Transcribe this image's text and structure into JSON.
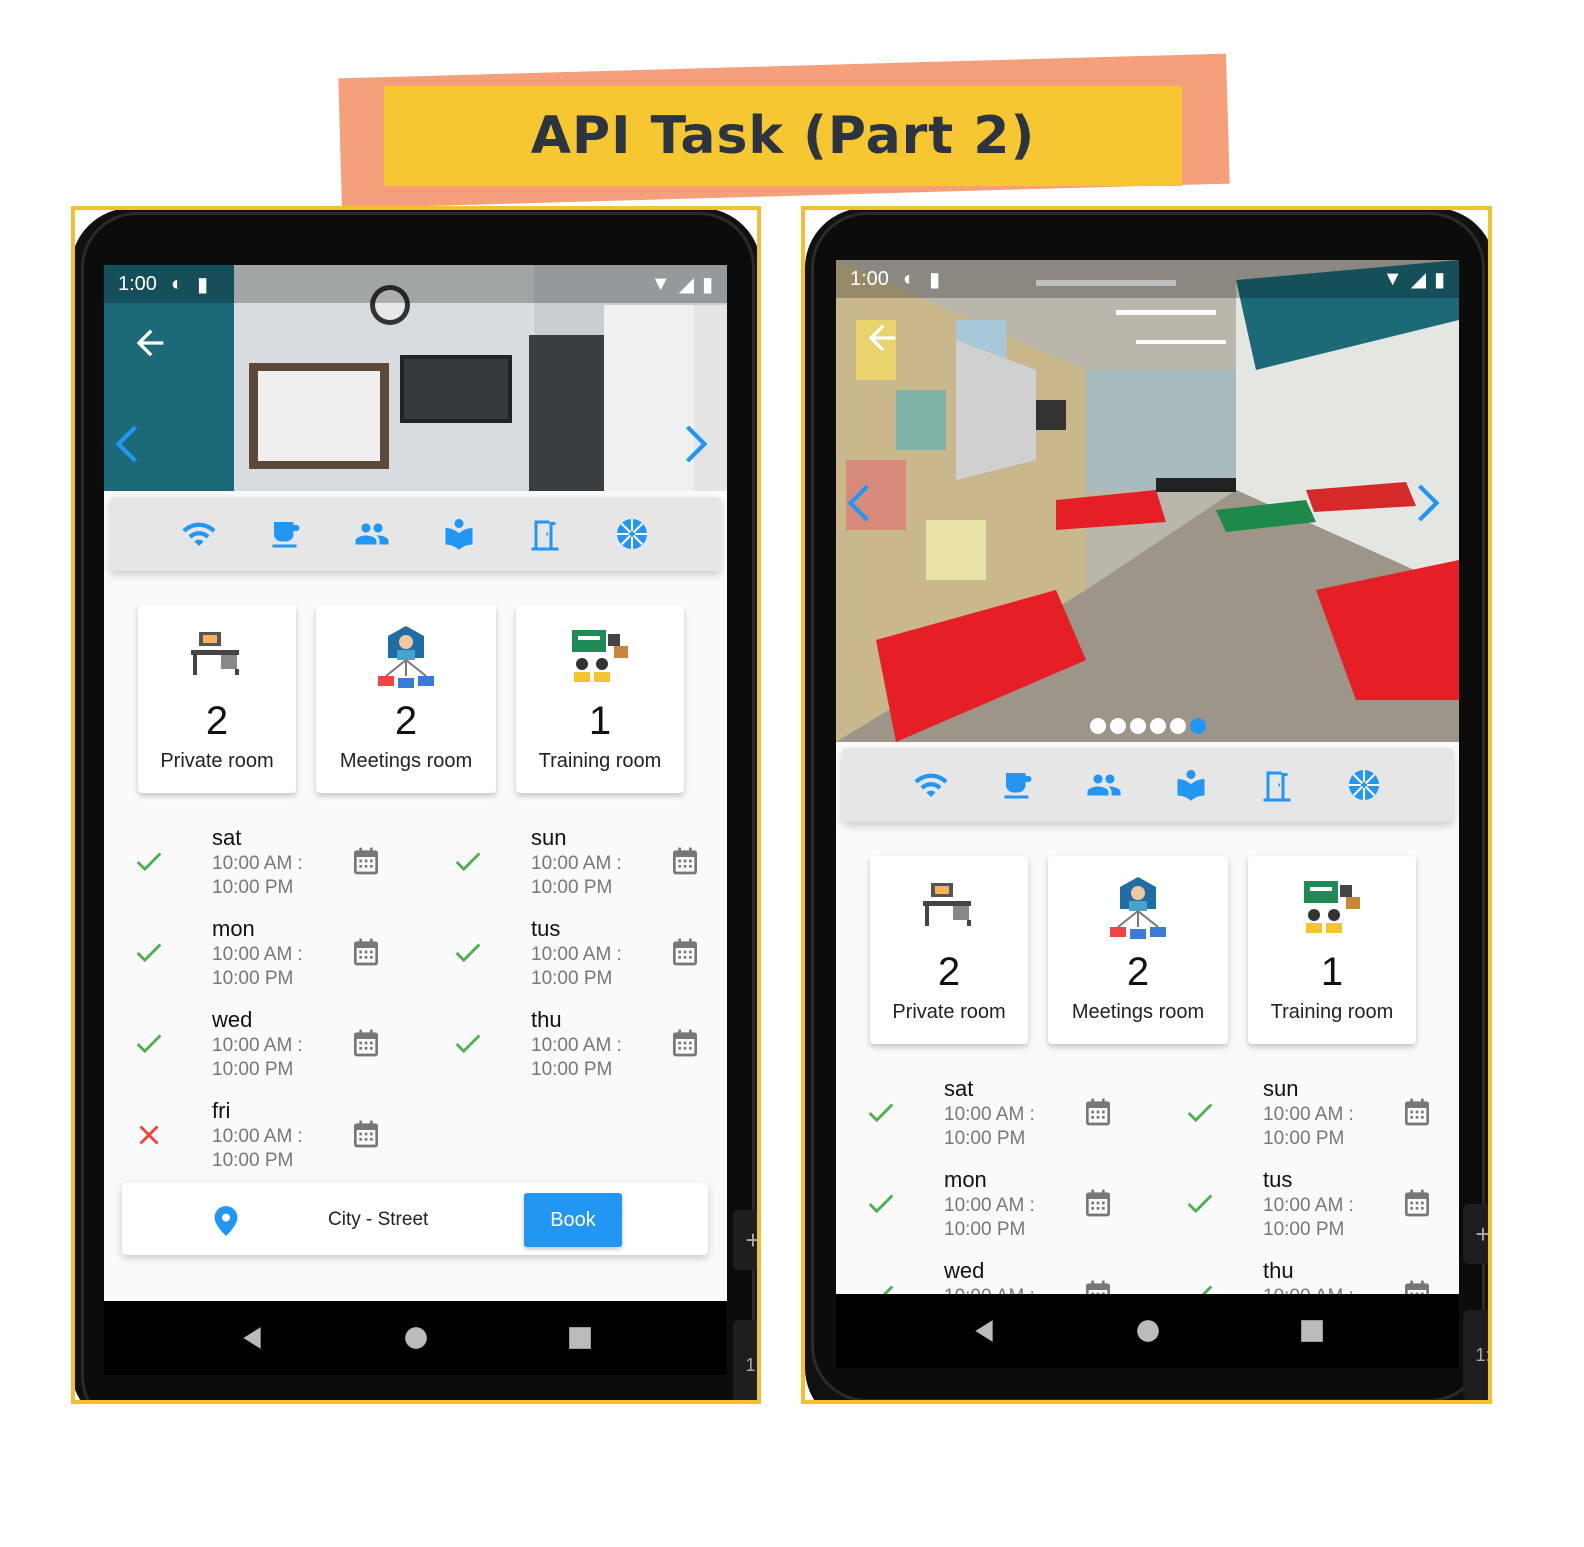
{
  "title": "API Task (Part 2)",
  "colors": {
    "accent": "#2196f3",
    "banner": "#f6c731",
    "banner_shadow": "#f5a07a",
    "frame": "#f2c12e",
    "ok": "#4caf50",
    "closed": "#f44336"
  },
  "status_bar": {
    "time": "1:00"
  },
  "amenities": [
    "wifi-icon",
    "coffee-icon",
    "people-icon",
    "reading-icon",
    "door-icon",
    "aperture-icon"
  ],
  "rooms": [
    {
      "count": "2",
      "label": "Private room",
      "icon": "desk-icon"
    },
    {
      "count": "2",
      "label": "Meetings room",
      "icon": "meeting-icon"
    },
    {
      "count": "1",
      "label": "Training room",
      "icon": "training-icon"
    }
  ],
  "schedule": [
    {
      "day": "sat",
      "from": "10:00 AM :",
      "to": "10:00 PM",
      "open": true
    },
    {
      "day": "sun",
      "from": "10:00 AM :",
      "to": "10:00 PM",
      "open": true
    },
    {
      "day": "mon",
      "from": "10:00 AM :",
      "to": "10:00 PM",
      "open": true
    },
    {
      "day": "tus",
      "from": "10:00 AM :",
      "to": "10:00 PM",
      "open": true
    },
    {
      "day": "wed",
      "from": "10:00 AM :",
      "to": "10:00 PM",
      "open": true
    },
    {
      "day": "thu",
      "from": "10:00 AM :",
      "to": "10:00 PM",
      "open": true
    },
    {
      "day": "fri",
      "from": "10:00 AM :",
      "to": "10:00 PM",
      "open": false
    }
  ],
  "book_bar": {
    "address": "City - Street",
    "button": "Book"
  },
  "carousel": {
    "dot_count": 6,
    "active_index": 5
  }
}
